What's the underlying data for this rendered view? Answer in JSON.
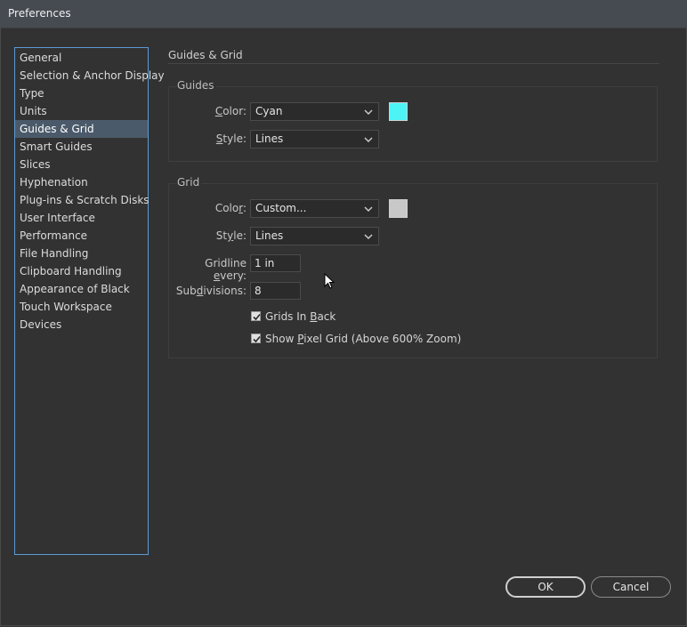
{
  "window": {
    "title": "Preferences"
  },
  "sidebar": {
    "items": [
      {
        "label": "General"
      },
      {
        "label": "Selection & Anchor Display"
      },
      {
        "label": "Type"
      },
      {
        "label": "Units"
      },
      {
        "label": "Guides & Grid",
        "selected": true
      },
      {
        "label": "Smart Guides"
      },
      {
        "label": "Slices"
      },
      {
        "label": "Hyphenation"
      },
      {
        "label": "Plug-ins & Scratch Disks"
      },
      {
        "label": "User Interface"
      },
      {
        "label": "Performance"
      },
      {
        "label": "File Handling"
      },
      {
        "label": "Clipboard Handling"
      },
      {
        "label": "Appearance of Black"
      },
      {
        "label": "Touch Workspace"
      },
      {
        "label": "Devices"
      }
    ]
  },
  "main": {
    "heading": "Guides & Grid",
    "guides": {
      "group_label": "Guides",
      "color_label": "Color:",
      "color_value": "Cyan",
      "color_swatch": "#4df3f5",
      "style_label": "Style:",
      "style_value": "Lines"
    },
    "grid": {
      "group_label": "Grid",
      "color_label": "Color:",
      "color_value": "Custom...",
      "color_swatch": "#c8c8c8",
      "style_label": "Style:",
      "style_value": "Lines",
      "gridline_label": "Gridline every:",
      "gridline_value": "1 in",
      "subdivisions_label": "Subdivisions:",
      "subdivisions_value": "8",
      "grids_in_back_label": "Grids In Back",
      "grids_in_back_checked": true,
      "pixel_grid_label": "Show Pixel Grid (Above 600% Zoom)",
      "pixel_grid_checked": true
    }
  },
  "footer": {
    "ok_label": "OK",
    "cancel_label": "Cancel"
  }
}
